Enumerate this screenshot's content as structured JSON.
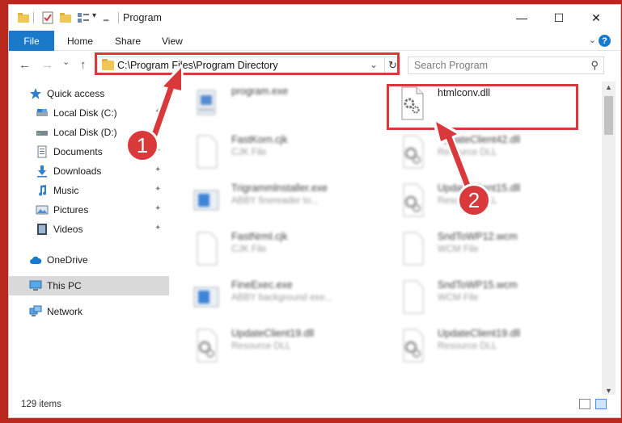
{
  "window": {
    "title": "Program"
  },
  "title_bar": {
    "minimize_glyph": "—",
    "maximize_glyph": "☐",
    "close_glyph": "✕",
    "qa_dropdown_glyph": "▾"
  },
  "ribbon": {
    "file": "File",
    "tabs": [
      "Home",
      "Share",
      "View"
    ],
    "collapse_glyph": "⌄",
    "help_glyph": "?"
  },
  "navigation": {
    "back_glyph": "←",
    "forward_glyph": "→",
    "recent_glyph": "⌄",
    "up_glyph": "↑",
    "address": "C:\\Program Files\\Program Directory",
    "address_dropdown_glyph": "⌄",
    "refresh_glyph": "↻",
    "search_placeholder": "Search Program",
    "search_glyph": "⚲"
  },
  "sidebar": {
    "pin_glyph": "✦",
    "items": [
      {
        "label": "Quick access",
        "icon": "star-icon"
      },
      {
        "label": "Local Disk (C:)",
        "icon": "drive-icon"
      },
      {
        "label": "Local Disk (D:)",
        "icon": "drive-icon"
      },
      {
        "label": "Documents",
        "icon": "documents-icon"
      },
      {
        "label": "Downloads",
        "icon": "downloads-icon"
      },
      {
        "label": "Music",
        "icon": "music-icon"
      },
      {
        "label": "Pictures",
        "icon": "pictures-icon"
      },
      {
        "label": "Videos",
        "icon": "videos-icon"
      },
      {
        "label": "OneDrive",
        "icon": "cloud-icon"
      },
      {
        "label": "This PC",
        "icon": "computer-icon"
      },
      {
        "label": "Network",
        "icon": "network-icon"
      }
    ]
  },
  "files": {
    "left": [
      {
        "name": "program.exe",
        "type": ""
      },
      {
        "name": "FastKorn.cjk",
        "type": "CJK File"
      },
      {
        "name": "Trigrammlnstaller.exe",
        "type": "ABBY finereader to..."
      },
      {
        "name": "FastNrml.cjk",
        "type": "CJK File"
      },
      {
        "name": "FineExec.exe",
        "type": "ABBY background exe..."
      },
      {
        "name": "UpdateClient19.dll",
        "type": "Resource DLL"
      }
    ],
    "right": [
      {
        "name": "htmlconv.dll",
        "type": ""
      },
      {
        "name": "UpdateClient42.dll",
        "type": "Resource DLL"
      },
      {
        "name": "UpdateClient15.dll",
        "type": "Resource DLL"
      },
      {
        "name": "SndToWP12.wcm",
        "type": "WCM File"
      },
      {
        "name": "SndToWP15.wcm",
        "type": "WCM File"
      },
      {
        "name": "UpdateClient19.dll",
        "type": "Resource DLL"
      }
    ]
  },
  "scrollbar": {
    "up_glyph": "▲",
    "down_glyph": "▼"
  },
  "status": {
    "item_count": "129 items"
  },
  "annotations": {
    "badge_1": "1",
    "badge_2": "2",
    "color": "#d9393b"
  }
}
